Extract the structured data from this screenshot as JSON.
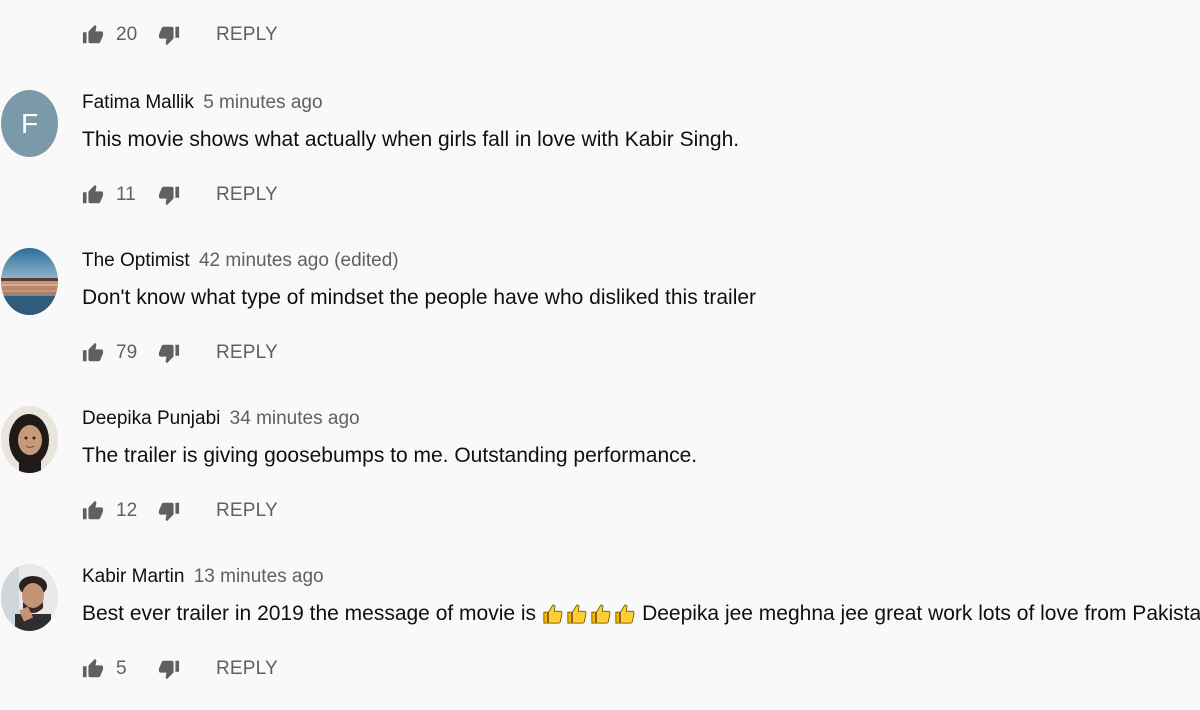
{
  "top_actions": {
    "likes": "20",
    "reply_label": "REPLY"
  },
  "comments": [
    {
      "author": "Fatima Mallik",
      "time": "5 minutes ago",
      "avatar_letter": "F",
      "avatar_color": "#7b9aa9",
      "text": "This movie shows what actually when girls fall in love with Kabir Singh.",
      "likes": "11",
      "reply_label": "REPLY"
    },
    {
      "author": "The Optimist",
      "time": "42 minutes ago (edited)",
      "text": "Don't know what type of mindset the people have who disliked this trailer",
      "likes": "79",
      "reply_label": "REPLY"
    },
    {
      "author": "Deepika Punjabi",
      "time": "34 minutes ago",
      "text": "The trailer is giving goosebumps to me. Outstanding performance.",
      "likes": "12",
      "reply_label": "REPLY"
    },
    {
      "author": "Kabir Martin",
      "time": "13 minutes ago",
      "text_before": "Best ever trailer in 2019 the message of movie is",
      "text_after": "Deepika jee meghna jee great work lots of love from Pakistan",
      "emoji": "thumbs-up-emoji",
      "likes": "5",
      "reply_label": "REPLY"
    }
  ],
  "icons": {
    "like": "thumb-up-icon",
    "dislike": "thumb-down-icon"
  },
  "colors": {
    "background": "#f9f9f9",
    "secondary_text": "#606060",
    "primary_text": "#0f0f0f"
  }
}
